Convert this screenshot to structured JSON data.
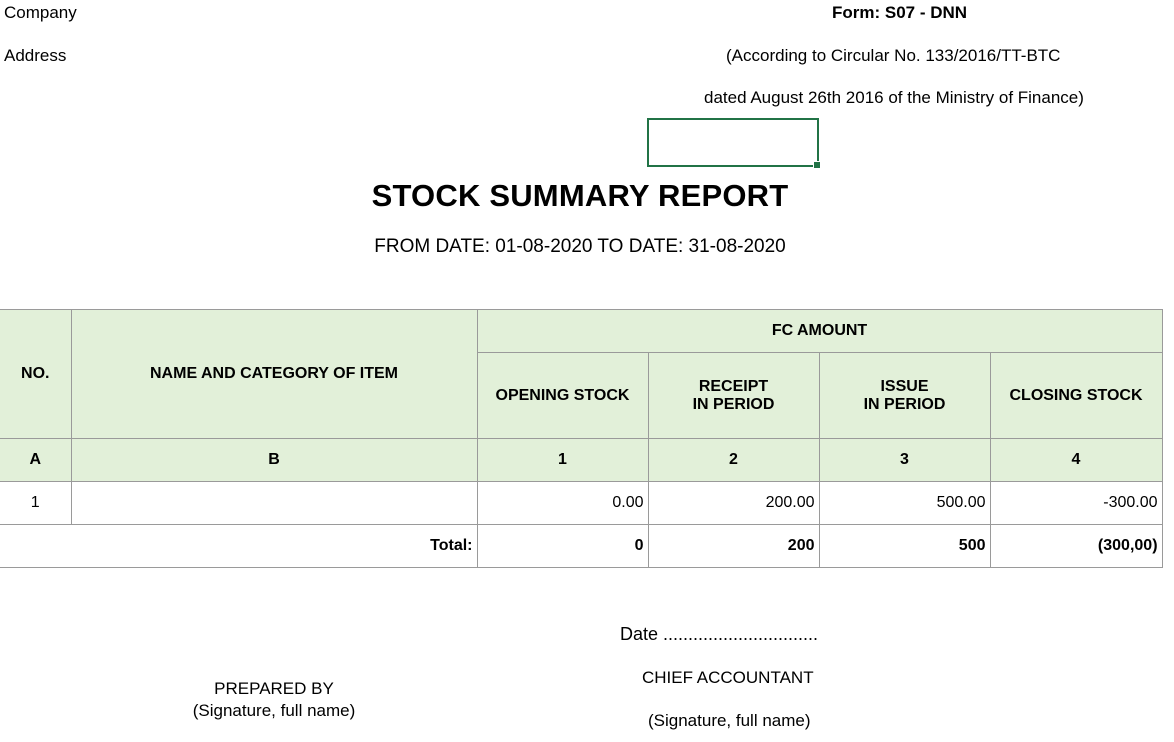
{
  "header": {
    "company_label": "Company",
    "address_label": "Address",
    "form_code": "Form: S07 - DNN",
    "circular": "(According to Circular No. 133/2016/TT-BTC",
    "dated": "dated August 26th 2016 of the Ministry of Finance)"
  },
  "report": {
    "title": "STOCK SUMMARY REPORT",
    "period": "FROM DATE: 01-08-2020 TO DATE: 31-08-2020"
  },
  "table": {
    "headers": {
      "no": "NO.",
      "name": "NAME AND CATEGORY OF ITEM",
      "fc_amount": "FC AMOUNT",
      "opening": "OPENING STOCK",
      "receipt_line1": "RECEIPT",
      "receipt_line2": "IN PERIOD",
      "issue_line1": "ISSUE",
      "issue_line2": "IN PERIOD",
      "closing": "CLOSING STOCK"
    },
    "codes": [
      "A",
      "B",
      "1",
      "2",
      "3",
      "4"
    ],
    "rows": [
      {
        "no": "1",
        "name": "",
        "opening": "0.00",
        "receipt": "200.00",
        "issue": "500.00",
        "closing": "-300.00"
      }
    ],
    "total": {
      "label": "Total:",
      "opening": "0",
      "receipt": "200",
      "issue": "500",
      "closing": "(300,00)"
    }
  },
  "signatures": {
    "date_line": "Date ...............................",
    "prepared_by": "PREPARED BY",
    "prepared_note": "(Signature, full name)",
    "chief_accountant": "CHIEF ACCOUNTANT",
    "chief_note": "(Signature, full name)"
  },
  "colors": {
    "header_fill": "#e2f0d9",
    "selection_border": "#217346",
    "grid_line": "#9a9a9a"
  }
}
